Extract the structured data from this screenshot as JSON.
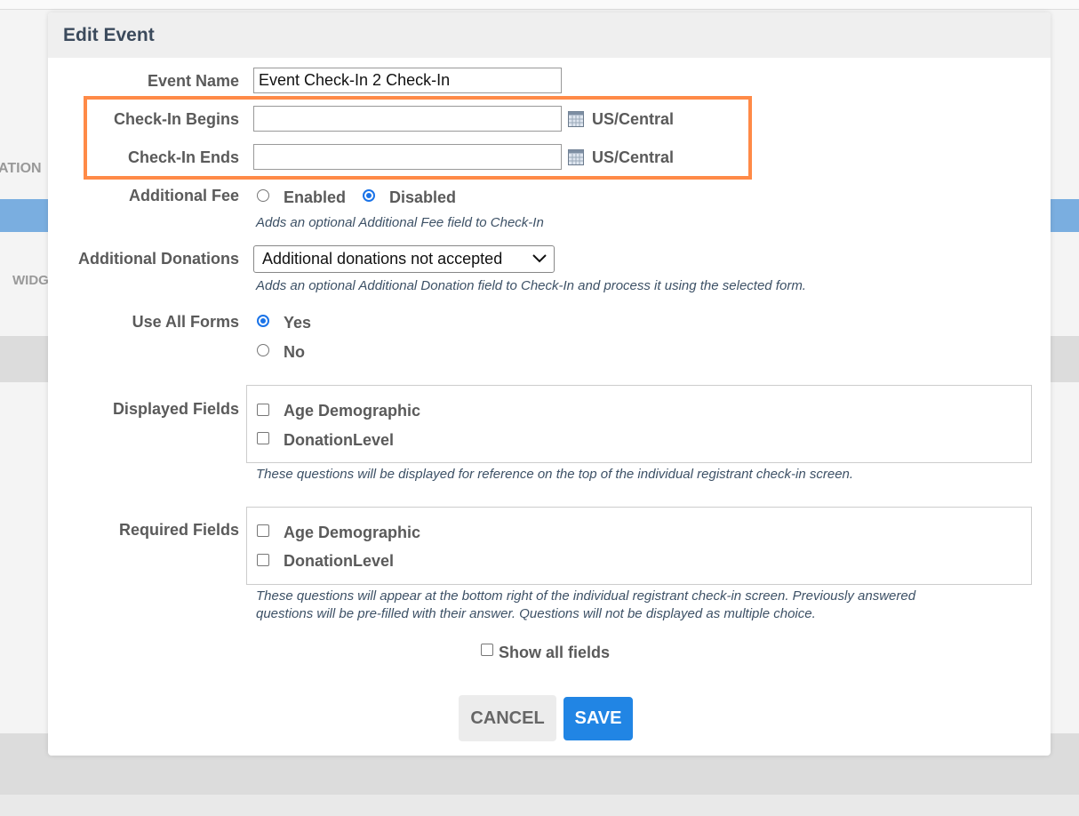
{
  "background": {
    "left_label_1": "ATION",
    "left_label_2": "WIDG"
  },
  "modal": {
    "title": "Edit Event",
    "event_name": {
      "label": "Event Name",
      "value": "Event Check-In 2 Check-In"
    },
    "checkin_begins": {
      "label": "Check-In Begins",
      "value": "",
      "timezone": "US/Central"
    },
    "checkin_ends": {
      "label": "Check-In Ends",
      "value": "",
      "timezone": "US/Central"
    },
    "additional_fee": {
      "label": "Additional Fee",
      "options": [
        "Enabled",
        "Disabled"
      ],
      "selected": "Disabled",
      "help": "Adds an optional Additional Fee field to Check-In"
    },
    "additional_donations": {
      "label": "Additional Donations",
      "selected": "Additional donations not accepted",
      "help": "Adds an optional Additional Donation field to Check-In and process it using the selected form."
    },
    "use_all_forms": {
      "label": "Use All Forms",
      "options": [
        "Yes",
        "No"
      ],
      "selected": "Yes"
    },
    "displayed_fields": {
      "label": "Displayed Fields",
      "items": [
        "Age Demographic",
        "DonationLevel"
      ],
      "help": "These questions will be displayed for reference on the top of the individual registrant check-in screen."
    },
    "required_fields": {
      "label": "Required Fields",
      "items": [
        "Age Demographic",
        "DonationLevel"
      ],
      "help_line1": "These questions will appear at the bottom right of the individual registrant check-in screen. Previously answered",
      "help_line2": "questions will be pre-filled with their answer. Questions will not be displayed as multiple choice."
    },
    "show_all_fields": "Show all fields",
    "cancel_label": "CANCEL",
    "save_label": "SAVE"
  },
  "colors": {
    "highlight": "#ff8a47",
    "accent": "#2185e4",
    "header_text": "#3b4a5c"
  }
}
